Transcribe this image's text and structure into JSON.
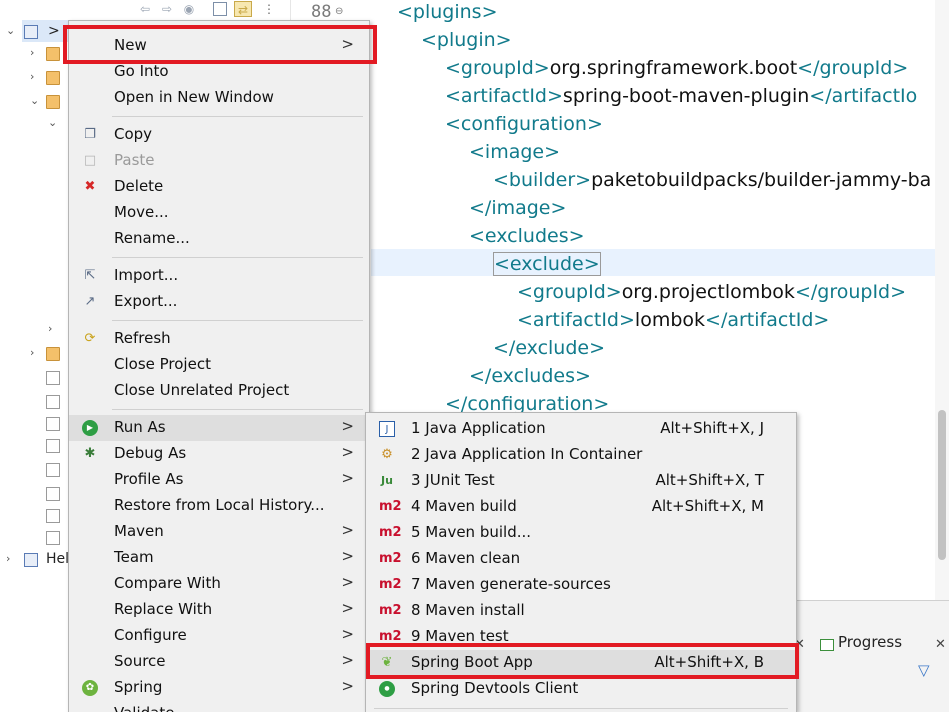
{
  "editor": {
    "line_number": "88",
    "lines": [
      {
        "indent": 0,
        "parts": [
          [
            "tag",
            "<plugins>"
          ]
        ]
      },
      {
        "indent": 1,
        "parts": [
          [
            "tag",
            "<plugin>"
          ]
        ]
      },
      {
        "indent": 2,
        "parts": [
          [
            "tag",
            "<groupId>"
          ],
          [
            "txt",
            "org.springframework.boot"
          ],
          [
            "tag",
            "</groupId>"
          ]
        ]
      },
      {
        "indent": 2,
        "parts": [
          [
            "tag",
            "<artifactId>"
          ],
          [
            "txt",
            "spring-boot-maven-plugin"
          ],
          [
            "tag",
            "</artifactIo"
          ]
        ]
      },
      {
        "indent": 2,
        "parts": [
          [
            "tag",
            "<configuration>"
          ]
        ]
      },
      {
        "indent": 3,
        "parts": [
          [
            "tag",
            "<image>"
          ]
        ]
      },
      {
        "indent": 4,
        "parts": [
          [
            "tag",
            "<builder>"
          ],
          [
            "txt",
            "paketobuildpacks/builder-jammy-ba"
          ]
        ]
      },
      {
        "indent": 3,
        "parts": [
          [
            "tag",
            "</image>"
          ]
        ]
      },
      {
        "indent": 3,
        "parts": [
          [
            "tag",
            "<excludes>"
          ]
        ]
      },
      {
        "indent": 4,
        "parts": [
          [
            "tag",
            "<exclude>"
          ]
        ]
      },
      {
        "indent": 5,
        "parts": [
          [
            "tag",
            "<groupId>"
          ],
          [
            "txt",
            "org.projectlombok"
          ],
          [
            "tag",
            "</groupId>"
          ]
        ]
      },
      {
        "indent": 5,
        "parts": [
          [
            "tag",
            "<artifactId>"
          ],
          [
            "txt",
            "lombok"
          ],
          [
            "tag",
            "</artifactId>"
          ]
        ]
      },
      {
        "indent": 4,
        "parts": [
          [
            "tag",
            "</exclude>"
          ]
        ]
      },
      {
        "indent": 3,
        "parts": [
          [
            "tag",
            "</excludes>"
          ]
        ]
      },
      {
        "indent": 2,
        "parts": [
          [
            "tag",
            "</configuration>"
          ]
        ]
      }
    ]
  },
  "explorer": {
    "collapse_arrow": ">",
    "help_label": "Hel"
  },
  "bottom_panel": {
    "tab_label": "Progress"
  },
  "context_menu": {
    "items": [
      {
        "label": "New",
        "icon": "",
        "arrow": ">"
      },
      {
        "label": "Go Into",
        "icon": ""
      },
      {
        "label": "Open in New Window",
        "icon": ""
      },
      {
        "label": "Copy",
        "icon": "copy-icon"
      },
      {
        "label": "Paste",
        "icon": "paste-icon",
        "disabled": true
      },
      {
        "label": "Delete",
        "icon": "delete-icon"
      },
      {
        "label": "Move...",
        "icon": ""
      },
      {
        "label": "Rename...",
        "icon": ""
      },
      {
        "label": "Import...",
        "icon": "import-icon"
      },
      {
        "label": "Export...",
        "icon": "export-icon"
      },
      {
        "label": "Refresh",
        "icon": "refresh-icon"
      },
      {
        "label": "Close Project",
        "icon": ""
      },
      {
        "label": "Close Unrelated Project",
        "icon": ""
      },
      {
        "label": "Run As",
        "icon": "run-icon",
        "arrow": ">"
      },
      {
        "label": "Debug As",
        "icon": "debug-icon",
        "arrow": ">"
      },
      {
        "label": "Profile As",
        "icon": "",
        "arrow": ">"
      },
      {
        "label": "Restore from Local History...",
        "icon": ""
      },
      {
        "label": "Maven",
        "icon": "",
        "arrow": ">"
      },
      {
        "label": "Team",
        "icon": "",
        "arrow": ">"
      },
      {
        "label": "Compare With",
        "icon": "",
        "arrow": ">"
      },
      {
        "label": "Replace With",
        "icon": "",
        "arrow": ">"
      },
      {
        "label": "Configure",
        "icon": "",
        "arrow": ">"
      },
      {
        "label": "Source",
        "icon": "",
        "arrow": ">"
      },
      {
        "label": "Spring",
        "icon": "spring-icon",
        "arrow": ">"
      },
      {
        "label": "Validate",
        "icon": ""
      }
    ]
  },
  "run_as_menu": {
    "items": [
      {
        "label": "1 Java Application",
        "shortcut": "Alt+Shift+X, J",
        "icon": "java-app-icon"
      },
      {
        "label": "2 Java Application In Container",
        "shortcut": "",
        "icon": "container-icon"
      },
      {
        "label": "3 JUnit Test",
        "shortcut": "Alt+Shift+X, T",
        "icon": "junit-icon"
      },
      {
        "label": "4 Maven build",
        "shortcut": "Alt+Shift+X, M",
        "icon": "maven-icon"
      },
      {
        "label": "5 Maven build...",
        "shortcut": "",
        "icon": "maven-icon"
      },
      {
        "label": "6 Maven clean",
        "shortcut": "",
        "icon": "maven-icon"
      },
      {
        "label": "7 Maven generate-sources",
        "shortcut": "",
        "icon": "maven-icon"
      },
      {
        "label": "8 Maven install",
        "shortcut": "",
        "icon": "maven-icon"
      },
      {
        "label": "9 Maven test",
        "shortcut": "",
        "icon": "maven-icon"
      },
      {
        "label": "Spring Boot App",
        "shortcut": "Alt+Shift+X, B",
        "icon": "spring-boot-icon"
      },
      {
        "label": "Spring Devtools Client",
        "shortcut": "",
        "icon": "devtools-icon"
      }
    ],
    "maven_badge": "m2",
    "junit_badge": "Ju"
  },
  "colors": {
    "highlight": "#e21a23",
    "xml_tag": "#117a8b",
    "menu_bg": "#f0f0f0"
  }
}
